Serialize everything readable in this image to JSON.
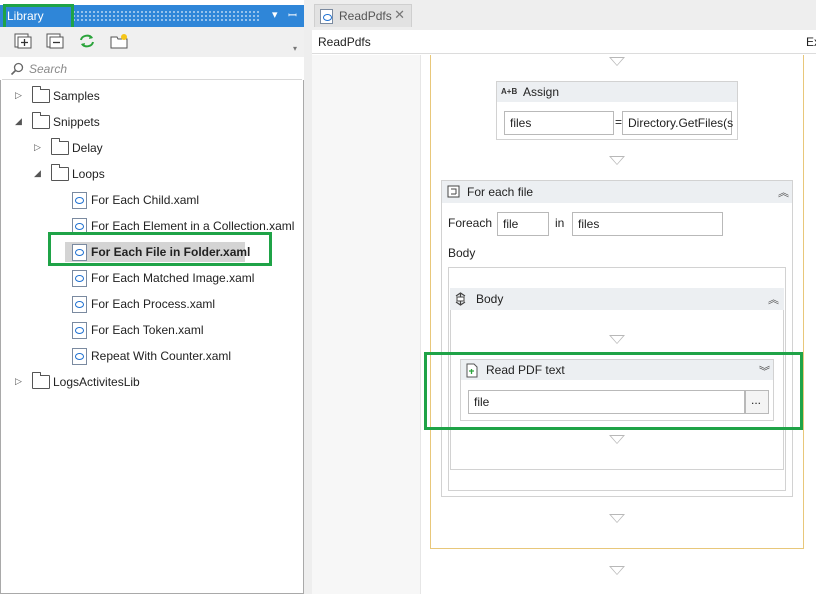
{
  "library": {
    "title": "Library",
    "search_placeholder": "Search",
    "tree": {
      "samples": "Samples",
      "snippets": "Snippets",
      "delay": "Delay",
      "loops": "Loops",
      "items": [
        "For Each Child.xaml",
        "For Each Element in a Collection.xaml",
        "For Each File in Folder.xaml",
        "For Each Matched Image.xaml",
        "For Each Process.xaml",
        "For Each Token.xaml",
        "Repeat With Counter.xaml"
      ],
      "logs_lib": "LogsActivitesLib"
    }
  },
  "designer": {
    "tab_label": "ReadPdfs",
    "breadcrumb": "ReadPdfs",
    "expand_label": "Ex",
    "assign": {
      "icon_text": "A+B",
      "title": "Assign",
      "to_value": "files",
      "equals": "=",
      "value": "Directory.GetFiles(s"
    },
    "foreach": {
      "title": "For each file",
      "foreach_label": "Foreach",
      "item_value": "file",
      "in_label": "in",
      "collection_value": "files",
      "body_label": "Body"
    },
    "body_sequence": {
      "title": "Body"
    },
    "read_pdf": {
      "title": "Read PDF text",
      "file_value": "file",
      "browse_label": "..."
    }
  },
  "colors": {
    "highlight": "#1fa347",
    "library_titlebar": "#2f86d8",
    "sequence_border": "#e8c77a"
  }
}
